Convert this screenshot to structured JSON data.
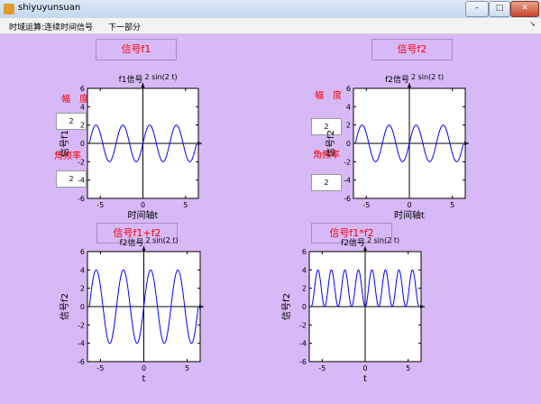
{
  "window": {
    "title": "shiyuyunsuan",
    "minimize_glyph": "–",
    "maximize_glyph": "□",
    "close_glyph": "✕"
  },
  "menu": {
    "items": [
      "时域运算:连续时间信号",
      "下一部分"
    ],
    "arrow": "➘"
  },
  "buttons": {
    "f1": "信号f1",
    "f2": "信号f2",
    "sum": "信号f1+f2",
    "prod": "信号f1*f2"
  },
  "controls": {
    "amp_label": "幅　度",
    "freq_label": "角频率",
    "amp_value": "2",
    "freq_value": "2"
  },
  "colors": {
    "background": "#d7b9f7",
    "label_red": "#ff0000",
    "curve": "#0000ff"
  },
  "chart_data": [
    {
      "type": "line",
      "title": "f1信号",
      "subtitle": "2 sin(2 t)",
      "xlabel": "时间轴t",
      "ylabel": "信号f1",
      "xlim": [
        -6.5,
        6.5
      ],
      "ylim": [
        -6,
        6
      ],
      "xticks": [
        -5,
        0,
        5
      ],
      "yticks": [
        -6,
        -4,
        -2,
        0,
        2,
        4,
        6
      ],
      "series": [
        {
          "function": "2*sin(2*t)"
        }
      ]
    },
    {
      "type": "line",
      "title": "f2信号",
      "subtitle": "2 sin(2 t)",
      "xlabel": "时间轴t",
      "ylabel": "信号f2",
      "xlim": [
        -6.5,
        6.5
      ],
      "ylim": [
        -6,
        6
      ],
      "xticks": [
        -5,
        0,
        5
      ],
      "yticks": [
        -6,
        -4,
        -2,
        0,
        2,
        4,
        6
      ],
      "series": [
        {
          "function": "2*sin(2*t)"
        }
      ]
    },
    {
      "type": "line",
      "title": "f2信号",
      "subtitle": "2 sin(2 t)",
      "xlabel": "t",
      "ylabel": "信号f2",
      "xlim": [
        -6.5,
        6.5
      ],
      "ylim": [
        -6,
        6
      ],
      "xticks": [
        -5,
        0,
        5
      ],
      "yticks": [
        -6,
        -4,
        -2,
        0,
        2,
        4,
        6
      ],
      "series": [
        {
          "function": "4*sin(2*t)"
        }
      ]
    },
    {
      "type": "line",
      "title": "f2信号",
      "subtitle": "2 sin(2 t)",
      "xlabel": "t",
      "ylabel": "信号f2",
      "xlim": [
        -6.5,
        6.5
      ],
      "ylim": [
        -6,
        6
      ],
      "xticks": [
        -5,
        0,
        5
      ],
      "yticks": [
        -6,
        -4,
        -2,
        0,
        2,
        4,
        6
      ],
      "series": [
        {
          "function": "4*sin(2*t)^2"
        }
      ]
    }
  ]
}
